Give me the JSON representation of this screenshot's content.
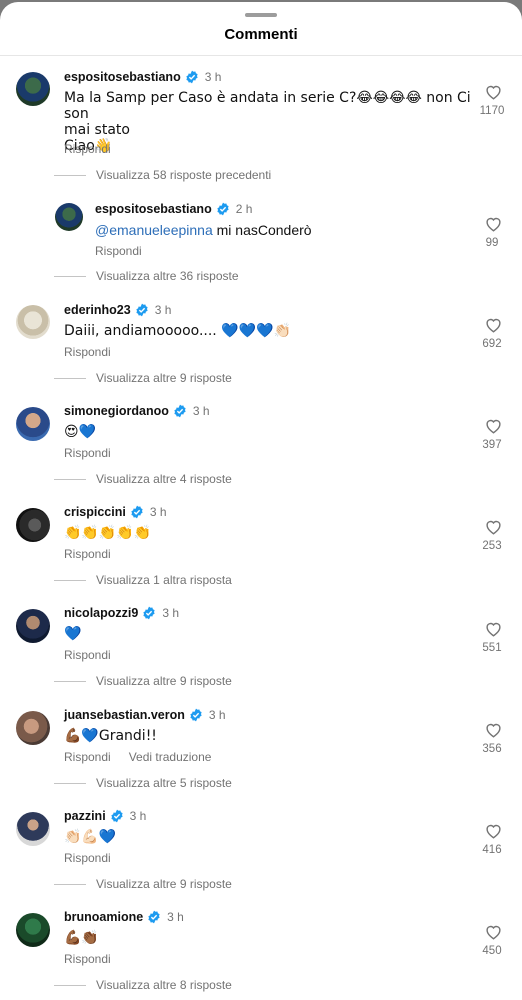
{
  "header": {
    "title": "Commenti"
  },
  "colors": {
    "verified": "#1d9bf0",
    "link": "#2d6eb8",
    "muted": "#737373"
  },
  "icons": {
    "like": "heart-outline-icon",
    "verified": "verified-badge-icon"
  },
  "comments": [
    {
      "username": "espositosebastiano",
      "time": "3 h",
      "text_lines": [
        "Ma la Samp per Caso è andata in serie C?😂😂😂😂 non Ci son",
        "mai stato",
        "Ciao👋"
      ],
      "reply_label": "Rispondi",
      "likes": "1170",
      "view_replies": "Visualizza 58 risposte precedenti"
    },
    {
      "username": "espositosebastiano",
      "time": "2 h",
      "mention": "@emanueleepinna",
      "text": " mi nasConderò",
      "reply_label": "Rispondi",
      "likes": "99",
      "view_replies": "Visualizza altre 36 risposte"
    },
    {
      "username": "ederinho23",
      "time": "3 h",
      "text": "Daiii, andiamooooo.... 💙💙💙👏🏻",
      "reply_label": "Rispondi",
      "likes": "692",
      "view_replies": "Visualizza altre 9 risposte"
    },
    {
      "username": "simonegiordanoo",
      "time": "3 h",
      "text": "😍💙",
      "reply_label": "Rispondi",
      "likes": "397",
      "view_replies": "Visualizza altre 4 risposte"
    },
    {
      "username": "crispiccini",
      "time": "3 h",
      "text": "👏👏👏👏👏",
      "reply_label": "Rispondi",
      "likes": "253",
      "view_replies": "Visualizza 1 altra risposta"
    },
    {
      "username": "nicolapozzi9",
      "time": "3 h",
      "text": "💙",
      "reply_label": "Rispondi",
      "likes": "551",
      "view_replies": "Visualizza altre 9 risposte"
    },
    {
      "username": "juansebastian.veron",
      "time": "3 h",
      "text": "💪🏾💙Grandi!!",
      "reply_label": "Rispondi",
      "translate_label": "Vedi traduzione",
      "likes": "356",
      "view_replies": "Visualizza altre 5 risposte"
    },
    {
      "username": "pazzini",
      "time": "3 h",
      "text": "👏🏻💪🏻💙",
      "reply_label": "Rispondi",
      "likes": "416",
      "view_replies": "Visualizza altre 9 risposte"
    },
    {
      "username": "brunoamione",
      "time": "3 h",
      "text": "💪🏾👏🏾",
      "reply_label": "Rispondi",
      "likes": "450",
      "view_replies": "Visualizza altre 8 risposte"
    }
  ]
}
